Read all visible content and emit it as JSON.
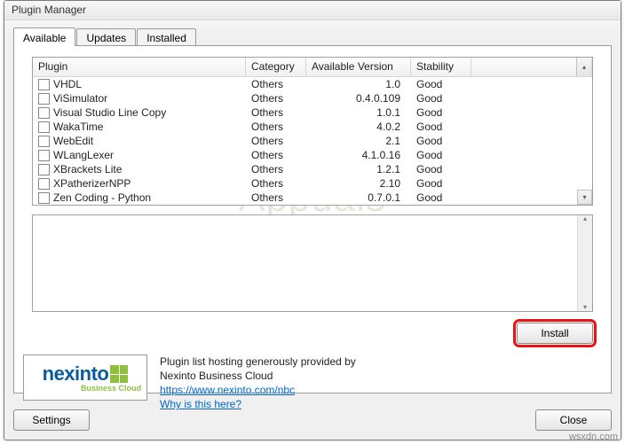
{
  "window": {
    "title": "Plugin Manager"
  },
  "tabs": [
    {
      "label": "Available",
      "active": true
    },
    {
      "label": "Updates",
      "active": false
    },
    {
      "label": "Installed",
      "active": false
    }
  ],
  "columns": {
    "plugin": "Plugin",
    "category": "Category",
    "version": "Available Version",
    "stability": "Stability"
  },
  "rows": [
    {
      "name": "VHDL",
      "category": "Others",
      "version": "1.0",
      "stability": "Good"
    },
    {
      "name": "ViSimulator",
      "category": "Others",
      "version": "0.4.0.109",
      "stability": "Good"
    },
    {
      "name": "Visual Studio Line Copy",
      "category": "Others",
      "version": "1.0.1",
      "stability": "Good"
    },
    {
      "name": "WakaTime",
      "category": "Others",
      "version": "4.0.2",
      "stability": "Good"
    },
    {
      "name": "WebEdit",
      "category": "Others",
      "version": "2.1",
      "stability": "Good"
    },
    {
      "name": "WLangLexer",
      "category": "Others",
      "version": "4.1.0.16",
      "stability": "Good"
    },
    {
      "name": "XBrackets Lite",
      "category": "Others",
      "version": "1.2.1",
      "stability": "Good"
    },
    {
      "name": "XPatherizerNPP",
      "category": "Others",
      "version": "2.10",
      "stability": "Good"
    },
    {
      "name": "Zen Coding - Python",
      "category": "Others",
      "version": "0.7.0.1",
      "stability": "Good"
    }
  ],
  "buttons": {
    "install": "Install",
    "settings": "Settings",
    "close": "Close"
  },
  "sponsor": {
    "line1": "Plugin list hosting generously provided by",
    "line2": "Nexinto Business Cloud",
    "link_text": "https://www.nexinto.com/nbc",
    "why": "Why is this here?",
    "logo_main": "nexinto",
    "logo_sub": "Business Cloud"
  },
  "watermark": "Appuals",
  "source_url": "wsxdn.com"
}
